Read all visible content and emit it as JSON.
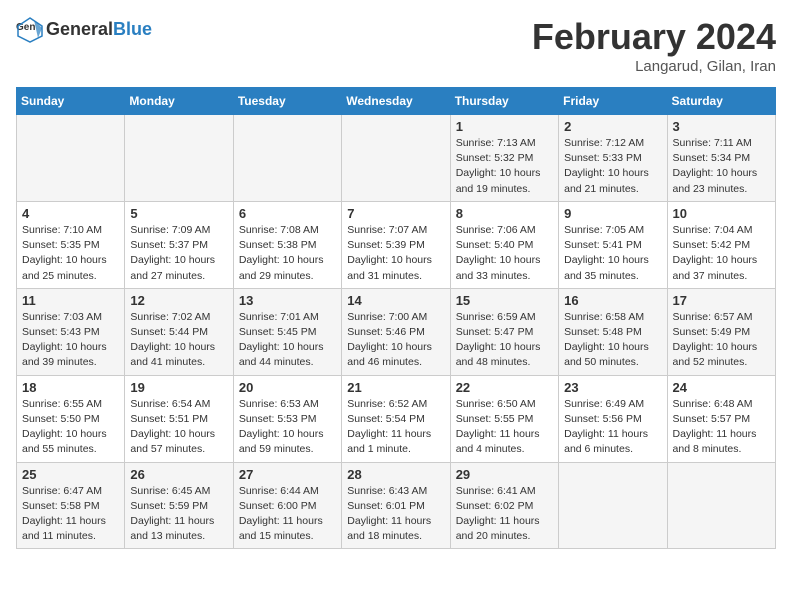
{
  "header": {
    "logo_line1": "General",
    "logo_line2": "Blue",
    "month_title": "February 2024",
    "subtitle": "Langarud, Gilan, Iran"
  },
  "weekdays": [
    "Sunday",
    "Monday",
    "Tuesday",
    "Wednesday",
    "Thursday",
    "Friday",
    "Saturday"
  ],
  "weeks": [
    [
      {
        "day": "",
        "info": ""
      },
      {
        "day": "",
        "info": ""
      },
      {
        "day": "",
        "info": ""
      },
      {
        "day": "",
        "info": ""
      },
      {
        "day": "1",
        "info": "Sunrise: 7:13 AM\nSunset: 5:32 PM\nDaylight: 10 hours\nand 19 minutes."
      },
      {
        "day": "2",
        "info": "Sunrise: 7:12 AM\nSunset: 5:33 PM\nDaylight: 10 hours\nand 21 minutes."
      },
      {
        "day": "3",
        "info": "Sunrise: 7:11 AM\nSunset: 5:34 PM\nDaylight: 10 hours\nand 23 minutes."
      }
    ],
    [
      {
        "day": "4",
        "info": "Sunrise: 7:10 AM\nSunset: 5:35 PM\nDaylight: 10 hours\nand 25 minutes."
      },
      {
        "day": "5",
        "info": "Sunrise: 7:09 AM\nSunset: 5:37 PM\nDaylight: 10 hours\nand 27 minutes."
      },
      {
        "day": "6",
        "info": "Sunrise: 7:08 AM\nSunset: 5:38 PM\nDaylight: 10 hours\nand 29 minutes."
      },
      {
        "day": "7",
        "info": "Sunrise: 7:07 AM\nSunset: 5:39 PM\nDaylight: 10 hours\nand 31 minutes."
      },
      {
        "day": "8",
        "info": "Sunrise: 7:06 AM\nSunset: 5:40 PM\nDaylight: 10 hours\nand 33 minutes."
      },
      {
        "day": "9",
        "info": "Sunrise: 7:05 AM\nSunset: 5:41 PM\nDaylight: 10 hours\nand 35 minutes."
      },
      {
        "day": "10",
        "info": "Sunrise: 7:04 AM\nSunset: 5:42 PM\nDaylight: 10 hours\nand 37 minutes."
      }
    ],
    [
      {
        "day": "11",
        "info": "Sunrise: 7:03 AM\nSunset: 5:43 PM\nDaylight: 10 hours\nand 39 minutes."
      },
      {
        "day": "12",
        "info": "Sunrise: 7:02 AM\nSunset: 5:44 PM\nDaylight: 10 hours\nand 41 minutes."
      },
      {
        "day": "13",
        "info": "Sunrise: 7:01 AM\nSunset: 5:45 PM\nDaylight: 10 hours\nand 44 minutes."
      },
      {
        "day": "14",
        "info": "Sunrise: 7:00 AM\nSunset: 5:46 PM\nDaylight: 10 hours\nand 46 minutes."
      },
      {
        "day": "15",
        "info": "Sunrise: 6:59 AM\nSunset: 5:47 PM\nDaylight: 10 hours\nand 48 minutes."
      },
      {
        "day": "16",
        "info": "Sunrise: 6:58 AM\nSunset: 5:48 PM\nDaylight: 10 hours\nand 50 minutes."
      },
      {
        "day": "17",
        "info": "Sunrise: 6:57 AM\nSunset: 5:49 PM\nDaylight: 10 hours\nand 52 minutes."
      }
    ],
    [
      {
        "day": "18",
        "info": "Sunrise: 6:55 AM\nSunset: 5:50 PM\nDaylight: 10 hours\nand 55 minutes."
      },
      {
        "day": "19",
        "info": "Sunrise: 6:54 AM\nSunset: 5:51 PM\nDaylight: 10 hours\nand 57 minutes."
      },
      {
        "day": "20",
        "info": "Sunrise: 6:53 AM\nSunset: 5:53 PM\nDaylight: 10 hours\nand 59 minutes."
      },
      {
        "day": "21",
        "info": "Sunrise: 6:52 AM\nSunset: 5:54 PM\nDaylight: 11 hours\nand 1 minute."
      },
      {
        "day": "22",
        "info": "Sunrise: 6:50 AM\nSunset: 5:55 PM\nDaylight: 11 hours\nand 4 minutes."
      },
      {
        "day": "23",
        "info": "Sunrise: 6:49 AM\nSunset: 5:56 PM\nDaylight: 11 hours\nand 6 minutes."
      },
      {
        "day": "24",
        "info": "Sunrise: 6:48 AM\nSunset: 5:57 PM\nDaylight: 11 hours\nand 8 minutes."
      }
    ],
    [
      {
        "day": "25",
        "info": "Sunrise: 6:47 AM\nSunset: 5:58 PM\nDaylight: 11 hours\nand 11 minutes."
      },
      {
        "day": "26",
        "info": "Sunrise: 6:45 AM\nSunset: 5:59 PM\nDaylight: 11 hours\nand 13 minutes."
      },
      {
        "day": "27",
        "info": "Sunrise: 6:44 AM\nSunset: 6:00 PM\nDaylight: 11 hours\nand 15 minutes."
      },
      {
        "day": "28",
        "info": "Sunrise: 6:43 AM\nSunset: 6:01 PM\nDaylight: 11 hours\nand 18 minutes."
      },
      {
        "day": "29",
        "info": "Sunrise: 6:41 AM\nSunset: 6:02 PM\nDaylight: 11 hours\nand 20 minutes."
      },
      {
        "day": "",
        "info": ""
      },
      {
        "day": "",
        "info": ""
      }
    ]
  ]
}
